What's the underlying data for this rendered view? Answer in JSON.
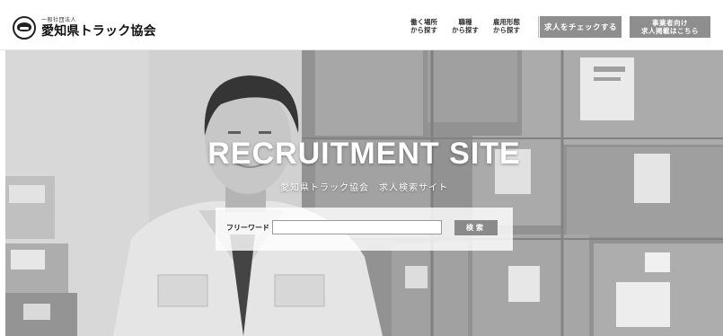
{
  "header": {
    "logo_sub": "一般社団法人",
    "logo_main": "愛知県トラック協会",
    "nav": [
      {
        "top": "働く場所",
        "bottom": "から探す"
      },
      {
        "top": "職種",
        "bottom": "から探す"
      },
      {
        "top": "雇用形態",
        "bottom": "から探す"
      }
    ],
    "check_button": "求人をチェックする",
    "employer_button_line1": "事業者向け",
    "employer_button_line2": "求人掲載はこちら"
  },
  "hero": {
    "title": "RECRUITMENT SITE",
    "subtitle": "愛知県トラック協会　求人検索サイト"
  },
  "search": {
    "label": "フリーワード",
    "placeholder": "",
    "value": "",
    "button": "検索"
  }
}
